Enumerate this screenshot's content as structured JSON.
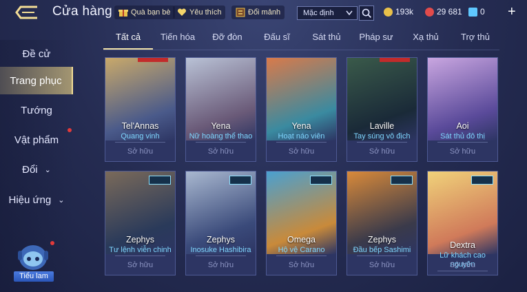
{
  "header": {
    "title": "Cửa hàng",
    "buttons": [
      {
        "label": "Quà bạn bè",
        "icon": "gift-icon"
      },
      {
        "label": "Yêu thích",
        "icon": "heart-icon"
      },
      {
        "label": "Đổi mảnh",
        "icon": "exchange-icon"
      }
    ],
    "sort": {
      "selected": "Mặc định"
    },
    "currencies": [
      {
        "icon": "gold-coin-icon",
        "value": "193k",
        "color": "#e9c04a"
      },
      {
        "icon": "ruby-icon",
        "value": "29 681",
        "color": "#e24b4b"
      },
      {
        "icon": "voucher-icon",
        "value": "0",
        "color": "#5fc8ff"
      }
    ]
  },
  "tabs": [
    "Tất cả",
    "Tiến hóa",
    "Đỡ đòn",
    "Đấu sĩ",
    "Sát thủ",
    "Pháp sư",
    "Xạ thủ",
    "Trợ thủ"
  ],
  "sidebar": {
    "items": [
      {
        "label": "Đề cử",
        "arrow": false
      },
      {
        "label": "Trang phục",
        "arrow": false,
        "active": true
      },
      {
        "label": "Tướng",
        "arrow": false
      },
      {
        "label": "Vật phẩm",
        "arrow": false,
        "dot": true
      },
      {
        "label": "Đổi",
        "arrow": true
      },
      {
        "label": "Hiệu ứng",
        "arrow": true
      }
    ],
    "mascot_label": "Tiểu lam"
  },
  "cards": [
    {
      "hero": "Tel'Annas",
      "skin": "Quang vinh",
      "status": "Sở hữu",
      "colors": [
        "#c9a96a",
        "#4a5a8a"
      ]
    },
    {
      "hero": "Yena",
      "skin": "Nữ hoàng thể thao",
      "status": "Sở hữu",
      "colors": [
        "#b9c2d6",
        "#6a5a78"
      ]
    },
    {
      "hero": "Yena",
      "skin": "Hoạt náo viên",
      "status": "Sở hữu",
      "colors": [
        "#d97a4a",
        "#3a8aa0"
      ]
    },
    {
      "hero": "Laville",
      "skin": "Tay súng vô địch",
      "status": "Sở hữu",
      "colors": [
        "#3a5a4a",
        "#1a2a38"
      ]
    },
    {
      "hero": "Aoi",
      "skin": "Sát thủ đô thị",
      "status": "Sở hữu",
      "colors": [
        "#c9a6e0",
        "#5a4a9a"
      ]
    },
    {
      "hero": "Zephys",
      "skin": "Tư lệnh viễn chinh",
      "status": "Sở hữu",
      "colors": [
        "#7a6a5a",
        "#2a3a5a"
      ]
    },
    {
      "hero": "Zephys",
      "skin": "Inosuke Hashibira",
      "status": "Sở hữu",
      "colors": [
        "#a9b8d0",
        "#3a4a7a"
      ]
    },
    {
      "hero": "Omega",
      "skin": "Hộ vệ Carano",
      "status": "Sở hữu",
      "colors": [
        "#4aa0d0",
        "#c98a3a"
      ]
    },
    {
      "hero": "Zephys",
      "skin": "Đầu bếp Sashimi",
      "status": "Sở hữu",
      "colors": [
        "#d98a3a",
        "#3a3a4a"
      ]
    },
    {
      "hero": "Dextra",
      "skin": "Lữ khách cao nguyên",
      "status": "Sở hữu",
      "colors": [
        "#f0d27a",
        "#d07a5a"
      ]
    }
  ]
}
